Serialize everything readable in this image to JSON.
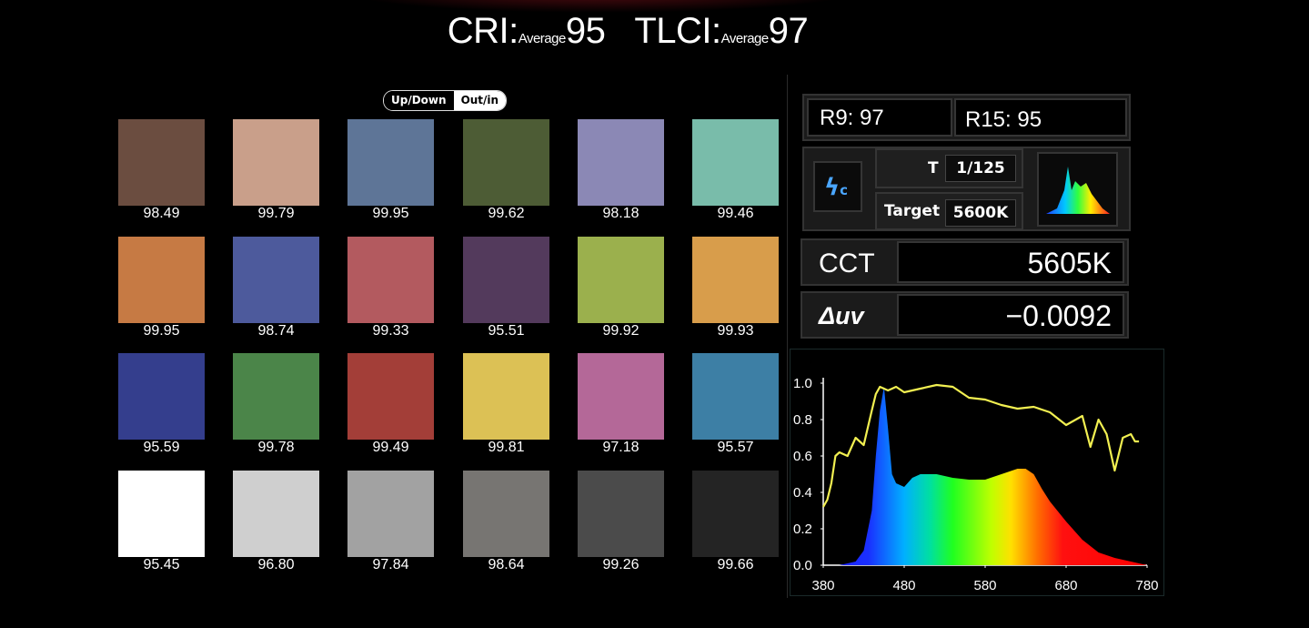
{
  "headline": {
    "cri_label": "CRI:",
    "cri_sub": "Average",
    "cri_value": "95",
    "tlci_label": "TLCI:",
    "tlci_sub": "Average",
    "tlci_value": "97"
  },
  "toggle": {
    "option_a": "Up/Down",
    "option_b": "Out/in",
    "selected": "Out/in"
  },
  "swatches": [
    {
      "color": "#6b4d40",
      "value": "98.49"
    },
    {
      "color": "#c99f8a",
      "value": "99.79"
    },
    {
      "color": "#5e7597",
      "value": "99.95"
    },
    {
      "color": "#4d5c35",
      "value": "99.62"
    },
    {
      "color": "#8b88b5",
      "value": "98.18"
    },
    {
      "color": "#79bcaa",
      "value": "99.46"
    },
    {
      "color": "#c67a44",
      "value": "99.95"
    },
    {
      "color": "#4d5a9c",
      "value": "98.74"
    },
    {
      "color": "#b35a5f",
      "value": "99.33"
    },
    {
      "color": "#533a5c",
      "value": "95.51"
    },
    {
      "color": "#9bb04d",
      "value": "99.92"
    },
    {
      "color": "#d89d4b",
      "value": "99.93"
    },
    {
      "color": "#343e8d",
      "value": "95.59"
    },
    {
      "color": "#4b8549",
      "value": "99.78"
    },
    {
      "color": "#a33e38",
      "value": "99.49"
    },
    {
      "color": "#dcc155",
      "value": "99.81"
    },
    {
      "color": "#b46898",
      "value": "97.18"
    },
    {
      "color": "#3d7fa5",
      "value": "95.57"
    },
    {
      "color": "#ffffff",
      "value": "95.45"
    },
    {
      "color": "#cfcfcf",
      "value": "96.80"
    },
    {
      "color": "#a2a2a2",
      "value": "97.84"
    },
    {
      "color": "#777572",
      "value": "98.64"
    },
    {
      "color": "#4b4b4b",
      "value": "99.26"
    },
    {
      "color": "#242424",
      "value": "99.66"
    }
  ],
  "meter": {
    "r9": "R9: 97",
    "r15": "R15: 95",
    "mode_icon": "flash-c-icon",
    "mode_symbol": "ϟ",
    "mode_letter": "c",
    "t_label": "T",
    "t_value": "1/125",
    "target_label": "Target",
    "target_value": "5600K",
    "cct_label": "CCT",
    "cct_value": "5605K",
    "duv_label": "Δuv",
    "duv_value": "−0.0092",
    "accent_flash": "#4aa6ff"
  },
  "chart_data": {
    "type": "area",
    "x_ticks": [
      "380",
      "480",
      "580",
      "680",
      "780"
    ],
    "y_ticks": [
      "0.0",
      "0.2",
      "0.4",
      "0.6",
      "0.8",
      "1.0"
    ],
    "xlim": [
      380,
      780
    ],
    "ylim": [
      0,
      1.0
    ],
    "grid": false,
    "series": [
      {
        "style": "spectrum-fill",
        "x": [
          380,
          400,
          420,
          430,
          440,
          445,
          450,
          455,
          460,
          465,
          470,
          480,
          490,
          500,
          520,
          540,
          560,
          580,
          600,
          620,
          630,
          640,
          650,
          660,
          680,
          700,
          720,
          740,
          760,
          770,
          780
        ],
        "y": [
          0.0,
          0.0,
          0.02,
          0.08,
          0.3,
          0.6,
          0.85,
          0.98,
          0.75,
          0.5,
          0.45,
          0.43,
          0.48,
          0.5,
          0.5,
          0.48,
          0.47,
          0.47,
          0.5,
          0.53,
          0.53,
          0.5,
          0.42,
          0.35,
          0.24,
          0.14,
          0.07,
          0.04,
          0.02,
          0.01,
          0.0
        ]
      },
      {
        "style": "yellow-line",
        "color": "#f2f051",
        "x": [
          380,
          385,
          390,
          395,
          400,
          410,
          420,
          430,
          440,
          445,
          450,
          455,
          460,
          470,
          480,
          500,
          520,
          540,
          560,
          580,
          600,
          620,
          640,
          660,
          680,
          700,
          710,
          720,
          730,
          740,
          750,
          760,
          765,
          770
        ],
        "y": [
          0.32,
          0.36,
          0.45,
          0.6,
          0.62,
          0.6,
          0.7,
          0.66,
          0.85,
          0.94,
          0.98,
          0.97,
          0.96,
          0.98,
          0.95,
          0.97,
          0.99,
          0.98,
          0.92,
          0.91,
          0.88,
          0.86,
          0.87,
          0.84,
          0.77,
          0.82,
          0.65,
          0.8,
          0.72,
          0.52,
          0.7,
          0.72,
          0.68,
          0.68
        ]
      }
    ]
  }
}
